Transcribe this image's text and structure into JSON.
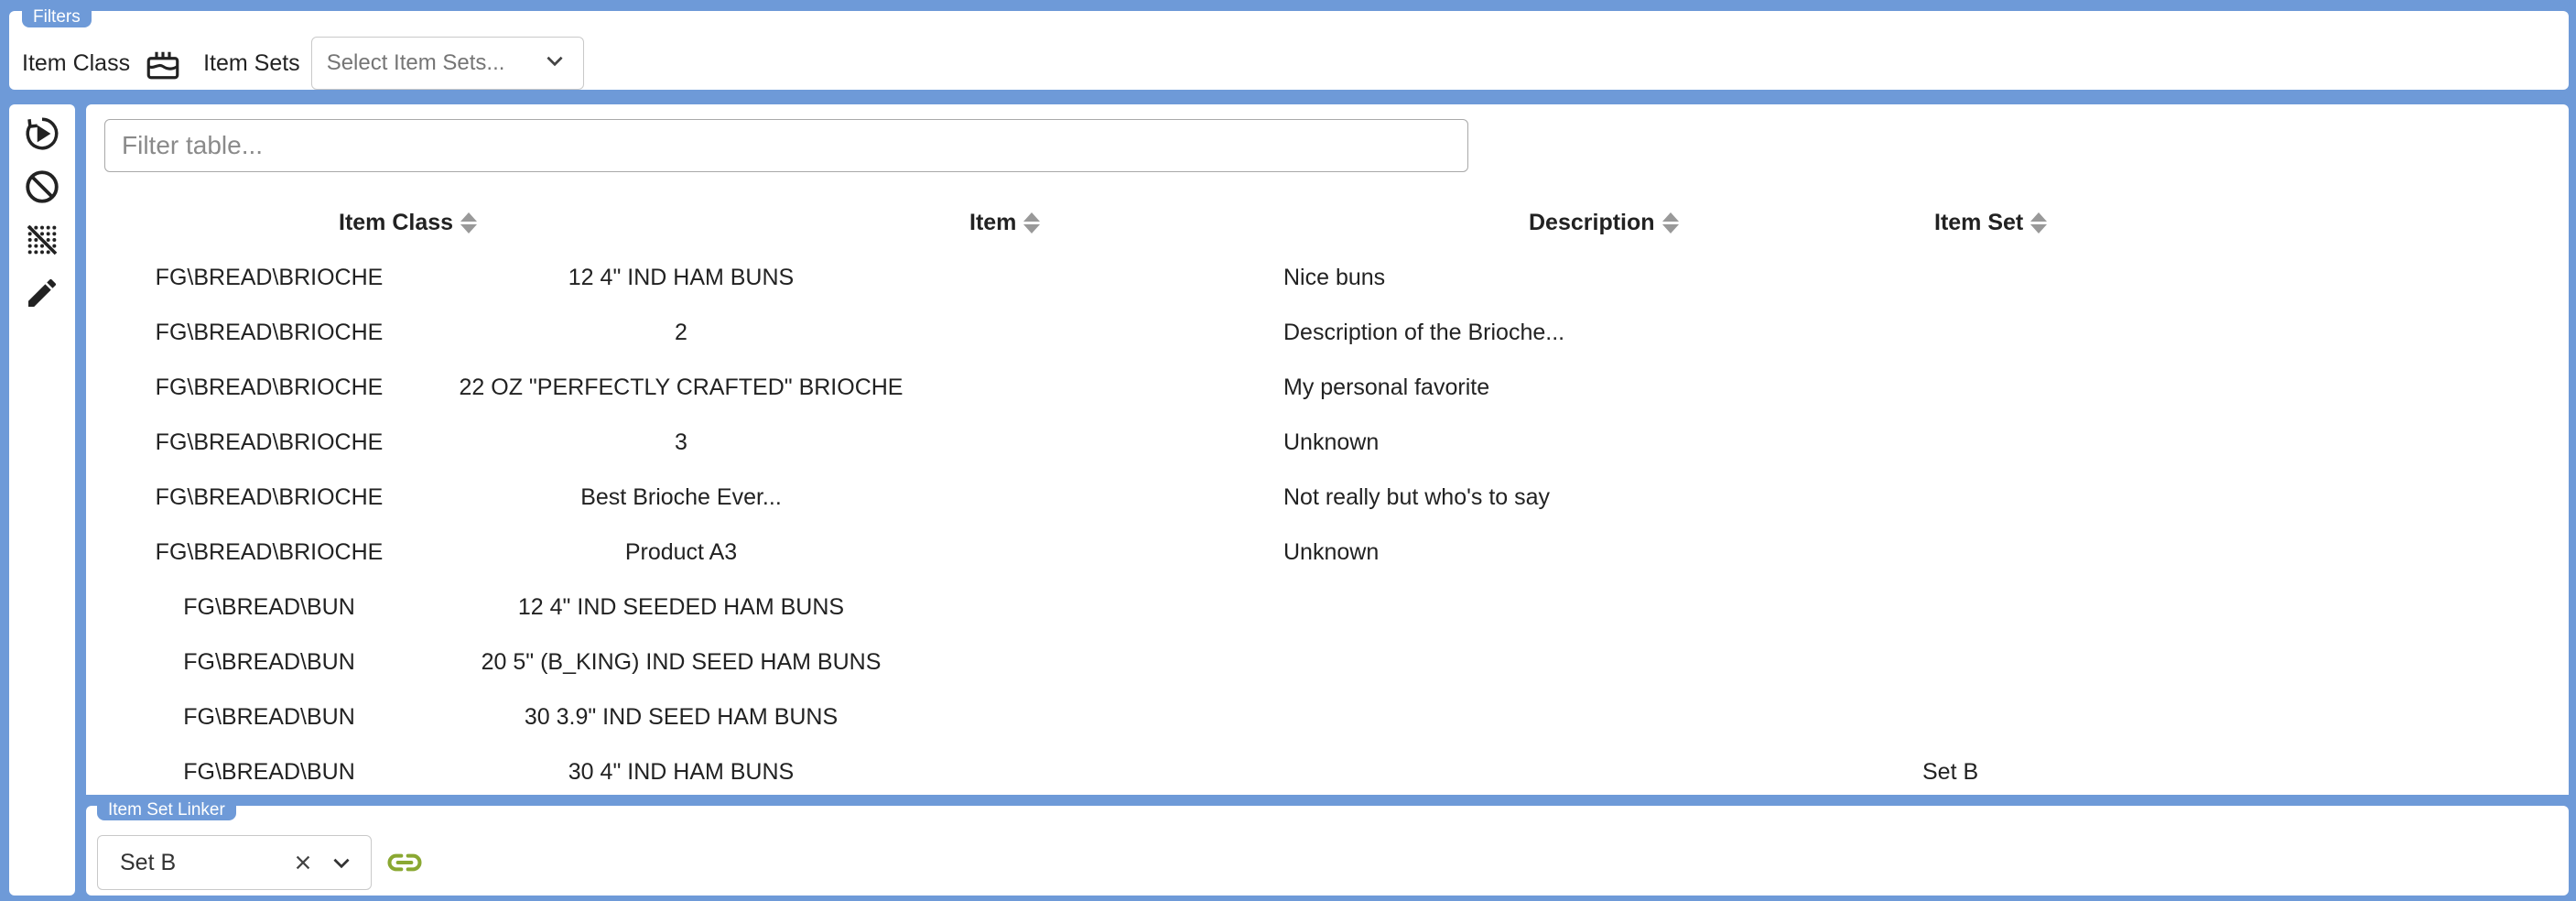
{
  "filters": {
    "legend": "Filters",
    "item_class_label": "Item Class",
    "item_sets_label": "Item Sets",
    "item_sets_placeholder": "Select Item Sets..."
  },
  "toolbar": {
    "icons": [
      "refresh-play-icon",
      "clear-icon",
      "remove-filter-icon",
      "edit-icon"
    ]
  },
  "table": {
    "filter_placeholder": "Filter table...",
    "columns": [
      "Item Class",
      "Item",
      "Description",
      "Item Set"
    ],
    "rows": [
      {
        "item_class": "FG\\BREAD\\BRIOCHE",
        "item": "12 4\" IND HAM BUNS",
        "description": "Nice buns",
        "item_set": ""
      },
      {
        "item_class": "FG\\BREAD\\BRIOCHE",
        "item": "2",
        "description": "Description of the Brioche...",
        "item_set": ""
      },
      {
        "item_class": "FG\\BREAD\\BRIOCHE",
        "item": "22 OZ \"PERFECTLY CRAFTED\" BRIOCHE",
        "description": "My personal favorite",
        "item_set": ""
      },
      {
        "item_class": "FG\\BREAD\\BRIOCHE",
        "item": "3",
        "description": "Unknown",
        "item_set": ""
      },
      {
        "item_class": "FG\\BREAD\\BRIOCHE",
        "item": "Best Brioche Ever...",
        "description": "Not really but who's to say",
        "item_set": ""
      },
      {
        "item_class": "FG\\BREAD\\BRIOCHE",
        "item": "Product A3",
        "description": "Unknown",
        "item_set": ""
      },
      {
        "item_class": "FG\\BREAD\\BUN",
        "item": "12 4\" IND SEEDED HAM BUNS",
        "description": "",
        "item_set": ""
      },
      {
        "item_class": "FG\\BREAD\\BUN",
        "item": "20 5\" (B_KING) IND SEED HAM BUNS",
        "description": "",
        "item_set": ""
      },
      {
        "item_class": "FG\\BREAD\\BUN",
        "item": "30 3.9\" IND SEED HAM BUNS",
        "description": "",
        "item_set": ""
      },
      {
        "item_class": "FG\\BREAD\\BUN",
        "item": "30 4\" IND HAM BUNS",
        "description": "",
        "item_set": "Set B"
      }
    ]
  },
  "linker": {
    "legend": "Item Set Linker",
    "selected_set": "Set B"
  },
  "colors": {
    "frame": "#6e9ad8",
    "link_icon": "#8aa832"
  }
}
